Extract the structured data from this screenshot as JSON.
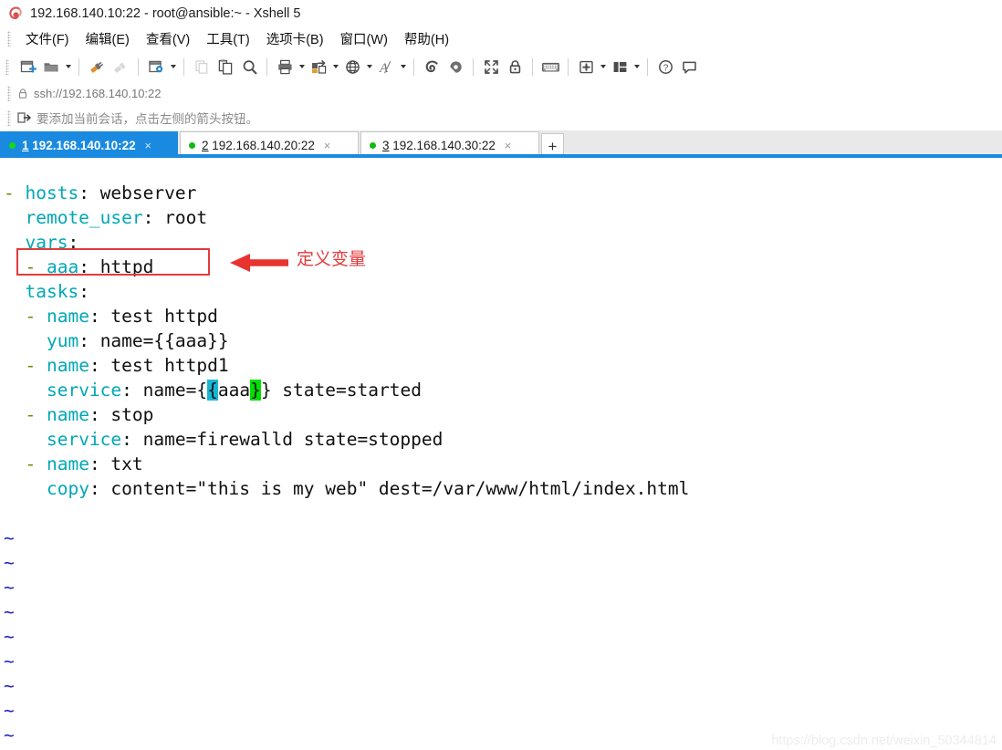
{
  "window": {
    "title": "192.168.140.10:22 - root@ansible:~ - Xshell 5",
    "logo_icon": "xshell-logo-icon"
  },
  "menu": {
    "items": [
      {
        "label": "文件(F)",
        "name": "menu-file"
      },
      {
        "label": "编辑(E)",
        "name": "menu-edit"
      },
      {
        "label": "查看(V)",
        "name": "menu-view"
      },
      {
        "label": "工具(T)",
        "name": "menu-tools"
      },
      {
        "label": "选项卡(B)",
        "name": "menu-tabs"
      },
      {
        "label": "窗口(W)",
        "name": "menu-window"
      },
      {
        "label": "帮助(H)",
        "name": "menu-help"
      }
    ]
  },
  "toolbar": {
    "items": [
      {
        "icon": "new-session-icon",
        "caret": false
      },
      {
        "icon": "open-folder-icon",
        "caret": true
      },
      {
        "sep": true
      },
      {
        "icon": "connect-plug-icon",
        "caret": false
      },
      {
        "icon": "disconnect-plug-icon",
        "caret": false
      },
      {
        "sep": true
      },
      {
        "icon": "session-properties-gear-icon",
        "caret": true
      },
      {
        "sep": true
      },
      {
        "icon": "copy-icon",
        "caret": false
      },
      {
        "icon": "paste-icon",
        "caret": false
      },
      {
        "icon": "find-search-icon",
        "caret": false
      },
      {
        "sep": true
      },
      {
        "icon": "print-icon",
        "caret": true
      },
      {
        "icon": "file-transfer-icon",
        "caret": true
      },
      {
        "icon": "globe-web-icon",
        "caret": true
      },
      {
        "icon": "font-size-icon",
        "caret": true
      },
      {
        "sep": true
      },
      {
        "icon": "shell-green-icon",
        "caret": false
      },
      {
        "icon": "shell-grey-icon",
        "caret": false
      },
      {
        "sep": true
      },
      {
        "icon": "fullscreen-icon",
        "caret": false
      },
      {
        "icon": "lock-icon",
        "caret": false
      },
      {
        "sep": true
      },
      {
        "icon": "keyboard-icon",
        "caret": false
      },
      {
        "sep": true
      },
      {
        "icon": "add-panel-icon",
        "caret": true
      },
      {
        "icon": "layout-arrange-icon",
        "caret": true
      },
      {
        "sep": true
      },
      {
        "icon": "help-question-icon",
        "caret": false
      },
      {
        "icon": "chat-bubble-icon",
        "caret": false
      }
    ]
  },
  "address_bar": {
    "lock_icon": "lock-icon",
    "url": "ssh://192.168.140.10:22"
  },
  "notice_bar": {
    "icon": "add-session-arrow-icon",
    "text": "要添加当前会话，点击左侧的箭头按钮。"
  },
  "tabs": {
    "items": [
      {
        "num": "1",
        "host": "192.168.140.10:22",
        "active": true,
        "close": "×",
        "status": "connected"
      },
      {
        "num": "2",
        "host": "192.168.140.20:22",
        "active": false,
        "close": "×",
        "status": "connected"
      },
      {
        "num": "3",
        "host": "192.168.140.30:22",
        "active": false,
        "close": "×",
        "status": "connected"
      }
    ],
    "add_label": "+"
  },
  "terminal": {
    "lines": [
      {
        "segments": [
          {
            "t": "- ",
            "c": "l-dash"
          },
          {
            "t": "hosts",
            "c": "l-key"
          },
          {
            "t": ": ",
            "c": "l-punct"
          },
          {
            "t": "webserver",
            "c": "l-val"
          }
        ]
      },
      {
        "segments": [
          {
            "t": "  ",
            "c": "l-val"
          },
          {
            "t": "remote_user",
            "c": "l-key"
          },
          {
            "t": ": ",
            "c": "l-punct"
          },
          {
            "t": "root",
            "c": "l-val"
          }
        ]
      },
      {
        "segments": [
          {
            "t": "  ",
            "c": "l-val"
          },
          {
            "t": "vars",
            "c": "l-key"
          },
          {
            "t": ":",
            "c": "l-punct"
          }
        ]
      },
      {
        "segments": [
          {
            "t": "  - ",
            "c": "l-dash"
          },
          {
            "t": "aaa",
            "c": "l-key"
          },
          {
            "t": ": ",
            "c": "l-punct"
          },
          {
            "t": "httpd",
            "c": "l-val"
          }
        ]
      },
      {
        "segments": [
          {
            "t": "  ",
            "c": "l-val"
          },
          {
            "t": "tasks",
            "c": "l-key"
          },
          {
            "t": ":",
            "c": "l-punct"
          }
        ]
      },
      {
        "segments": [
          {
            "t": "  - ",
            "c": "l-dash"
          },
          {
            "t": "name",
            "c": "l-key"
          },
          {
            "t": ": ",
            "c": "l-punct"
          },
          {
            "t": "test httpd",
            "c": "l-val"
          }
        ]
      },
      {
        "segments": [
          {
            "t": "    ",
            "c": "l-val"
          },
          {
            "t": "yum",
            "c": "l-key"
          },
          {
            "t": ": ",
            "c": "l-punct"
          },
          {
            "t": "name={{aaa}}",
            "c": "l-val"
          }
        ]
      },
      {
        "segments": [
          {
            "t": "  - ",
            "c": "l-dash"
          },
          {
            "t": "name",
            "c": "l-key"
          },
          {
            "t": ": ",
            "c": "l-punct"
          },
          {
            "t": "test httpd1",
            "c": "l-val"
          }
        ]
      },
      {
        "segments": [
          {
            "t": "    ",
            "c": "l-val"
          },
          {
            "t": "service",
            "c": "l-key"
          },
          {
            "t": ": ",
            "c": "l-punct"
          },
          {
            "t": "name={",
            "c": "l-val"
          },
          {
            "t": "{",
            "c": "cur-cyan"
          },
          {
            "t": "aaa",
            "c": "l-val"
          },
          {
            "t": "}",
            "c": "brace-green"
          },
          {
            "t": "} state=started",
            "c": "l-val"
          }
        ]
      },
      {
        "segments": [
          {
            "t": "  - ",
            "c": "l-dash"
          },
          {
            "t": "name",
            "c": "l-key"
          },
          {
            "t": ": ",
            "c": "l-punct"
          },
          {
            "t": "stop",
            "c": "l-val"
          }
        ]
      },
      {
        "segments": [
          {
            "t": "    ",
            "c": "l-val"
          },
          {
            "t": "service",
            "c": "l-key"
          },
          {
            "t": ": ",
            "c": "l-punct"
          },
          {
            "t": "name=firewalld state=stopped",
            "c": "l-val"
          }
        ]
      },
      {
        "segments": [
          {
            "t": "  - ",
            "c": "l-dash"
          },
          {
            "t": "name",
            "c": "l-key"
          },
          {
            "t": ": ",
            "c": "l-punct"
          },
          {
            "t": "txt",
            "c": "l-val"
          }
        ]
      },
      {
        "segments": [
          {
            "t": "    ",
            "c": "l-val"
          },
          {
            "t": "copy",
            "c": "l-key"
          },
          {
            "t": ": ",
            "c": "l-punct"
          },
          {
            "t": "content=\"this is my web\" dest=/var/www/html/index.html",
            "c": "l-val"
          }
        ]
      },
      {
        "segments": []
      },
      {
        "segments": [
          {
            "t": "~",
            "c": "tilde"
          }
        ]
      },
      {
        "segments": [
          {
            "t": "~",
            "c": "tilde"
          }
        ]
      },
      {
        "segments": [
          {
            "t": "~",
            "c": "tilde"
          }
        ]
      },
      {
        "segments": [
          {
            "t": "~",
            "c": "tilde"
          }
        ]
      },
      {
        "segments": [
          {
            "t": "~",
            "c": "tilde"
          }
        ]
      },
      {
        "segments": [
          {
            "t": "~",
            "c": "tilde"
          }
        ]
      },
      {
        "segments": [
          {
            "t": "~",
            "c": "tilde"
          }
        ]
      },
      {
        "segments": [
          {
            "t": "~",
            "c": "tilde"
          }
        ]
      },
      {
        "segments": [
          {
            "t": "~",
            "c": "tilde"
          }
        ]
      }
    ]
  },
  "annotations": {
    "callout_text": "定义变量",
    "callout_color": "#e23b3b",
    "highlight_box_color": "#e23b3b"
  },
  "watermark": {
    "text": "https://blog.csdn.net/weixin_50344814"
  },
  "colors": {
    "accent_blue": "#1a8ae0",
    "yaml_key": "#00a7b5",
    "yaml_dash": "#808000",
    "tilde_blue": "#2222cc",
    "cursor_cyan": "#17b7d4",
    "brace_green": "#00e000",
    "annotation_red": "#e23b3b"
  }
}
